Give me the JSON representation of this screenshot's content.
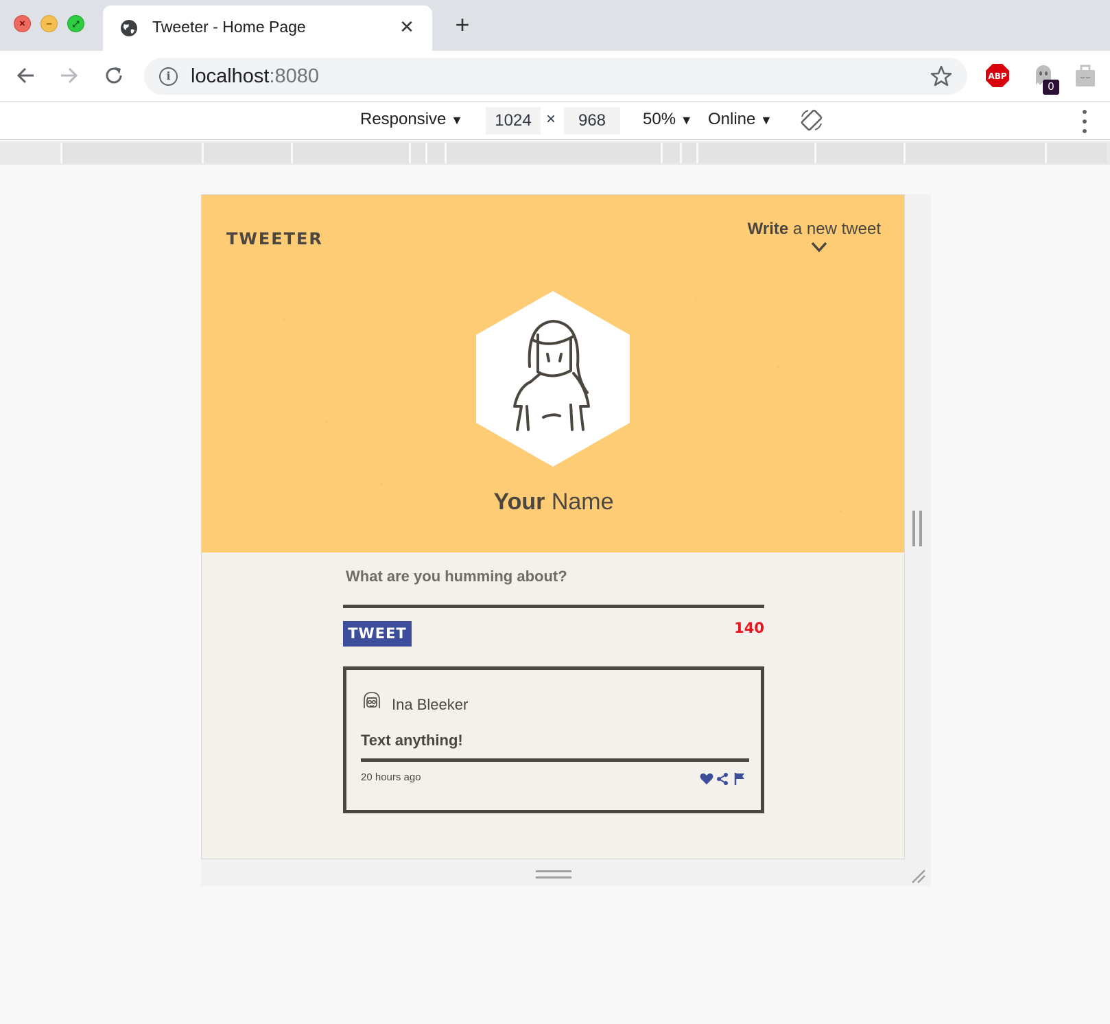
{
  "browser": {
    "tab_title": "Tweeter - Home Page",
    "url_host": "localhost",
    "url_port": ":8080",
    "icons": {
      "window_close": "close-icon",
      "window_minimize": "minimize-icon",
      "window_maximize": "maximize-icon",
      "tab_favicon": "globe-icon",
      "tab_close": "close-icon",
      "new_tab": "plus-icon",
      "back": "arrow-left-icon",
      "forward": "arrow-right-icon",
      "reload": "reload-icon",
      "site_info": "info-icon",
      "bookmark": "star-icon"
    },
    "extensions": {
      "adblock_label": "ABP",
      "ghostery_badge": "0"
    }
  },
  "devtools": {
    "device_mode": "Responsive",
    "width": "1024",
    "height": "968",
    "dimension_separator": "×",
    "zoom": "50%",
    "throttling": "Online",
    "dropdown_glyph": "▼"
  },
  "page": {
    "logo": "TWEETER",
    "compose_bold": "Write",
    "compose_rest": " a new tweet",
    "profile_bold": "Your",
    "profile_rest": " Name",
    "composer_placeholder": "What are you humming about?",
    "tweet_button": "TWEET",
    "char_counter": "140",
    "tweets": [
      {
        "author": "Ina Bleeker",
        "text": "Text anything!",
        "time": "20 hours ago",
        "actions": [
          "heart-icon",
          "share-icon",
          "flag-icon"
        ]
      }
    ]
  },
  "colors": {
    "hero_bg": "#fdcc75",
    "page_bg": "#f4f1ec",
    "ink": "#4b4740",
    "tweet_button_bg": "#3b4d9b",
    "counter_color": "#e8141f",
    "action_icons": "#3b4d9b"
  }
}
